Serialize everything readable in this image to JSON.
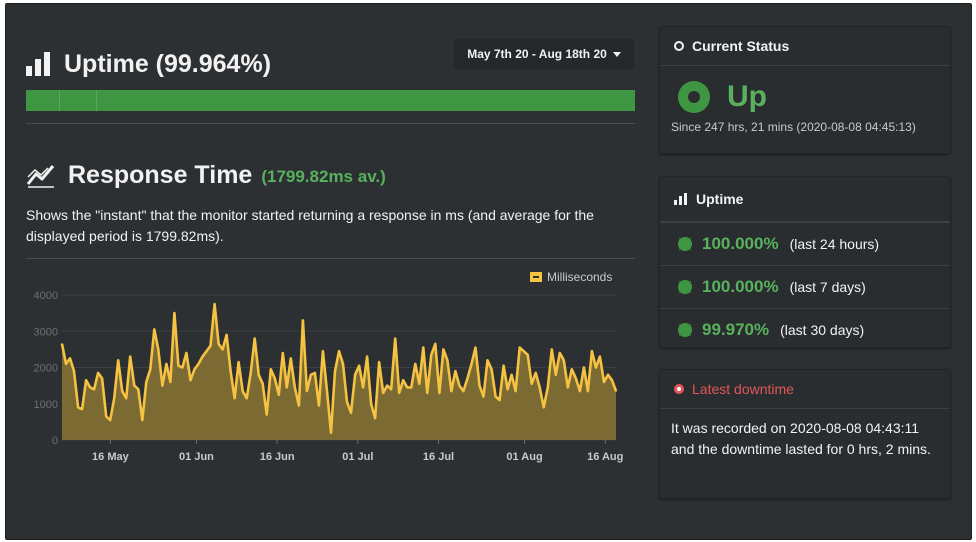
{
  "uptime": {
    "title": "Uptime (99.964%)",
    "date_range": "May 7th 20 - Aug 18th 20"
  },
  "response": {
    "title": "Response Time",
    "average": "(1799.82ms av.)",
    "description": "Shows the \"instant\" that the monitor started returning a response in ms (and average for the displayed period is 1799.82ms)."
  },
  "current_status": {
    "heading": "Current Status",
    "state": "Up",
    "since": "Since 247 hrs, 21 mins (2020-08-08 04:45:13)"
  },
  "uptime_panel": {
    "heading": "Uptime",
    "rows": [
      {
        "pct": "100.000%",
        "period": "(last 24 hours)"
      },
      {
        "pct": "100.000%",
        "period": "(last 7 days)"
      },
      {
        "pct": "99.970%",
        "period": "(last 30 days)"
      }
    ]
  },
  "downtime": {
    "heading": "Latest downtime",
    "text": "It was recorded on 2020-08-08 04:43:11 and the downtime lasted for 0 hrs, 2 mins."
  },
  "colors": {
    "accent_green": "#58b15c",
    "bar_green": "#3f9642",
    "line_yellow": "#f5c242",
    "alert_red": "#e05757"
  },
  "chart_data": {
    "type": "area",
    "legend": [
      "Milliseconds"
    ],
    "legend_placement": "top-right",
    "xlabel": "",
    "ylabel": "",
    "ylim": [
      0,
      4000
    ],
    "y_ticks": [
      "0",
      "1000",
      "2000",
      "3000",
      "4000"
    ],
    "x_ticks": [
      "16 May",
      "01 Jun",
      "16 Jun",
      "01 Jul",
      "16 Jul",
      "01 Aug",
      "16 Aug"
    ],
    "x_tick_days": [
      9,
      25,
      40,
      55,
      70,
      86,
      101
    ],
    "x_range_days": [
      0,
      103
    ],
    "grid": true,
    "series": [
      {
        "name": "Milliseconds",
        "values": [
          2650,
          2100,
          2250,
          1900,
          900,
          850,
          1650,
          1450,
          1400,
          1850,
          1700,
          650,
          550,
          1150,
          2200,
          1350,
          1150,
          2300,
          1500,
          1400,
          550,
          1600,
          1950,
          3050,
          2500,
          1500,
          2100,
          1600,
          3500,
          2050,
          2000,
          2400,
          1650,
          1950,
          2100,
          2300,
          2450,
          2600,
          3750,
          2650,
          2500,
          2900,
          1900,
          1150,
          2150,
          1350,
          1150,
          1850,
          2800,
          1800,
          1550,
          700,
          1950,
          1700,
          1250,
          2400,
          1450,
          2250,
          1450,
          950,
          3300,
          1350,
          1800,
          1850,
          950,
          2450,
          1350,
          200,
          1900,
          2450,
          2100,
          1050,
          750,
          1800,
          2050,
          1450,
          2300,
          1000,
          600,
          2150,
          1300,
          1500,
          1400,
          2800,
          1300,
          1650,
          1450,
          1450,
          2100,
          1550,
          2550,
          1300,
          2350,
          2650,
          1300,
          2500,
          2200,
          1350,
          1900,
          1500,
          1350,
          1700,
          2100,
          2550,
          1500,
          1200,
          2200,
          1950,
          1200,
          1100,
          2050,
          1400,
          1800,
          1350,
          2550,
          2450,
          2350,
          1550,
          1850,
          1450,
          900,
          1450,
          2500,
          1800,
          2400,
          2200,
          1450,
          1950,
          1700,
          1350,
          2000,
          1350,
          2450,
          2000,
          2300,
          1600,
          1800,
          1650,
          1350
        ]
      }
    ]
  }
}
